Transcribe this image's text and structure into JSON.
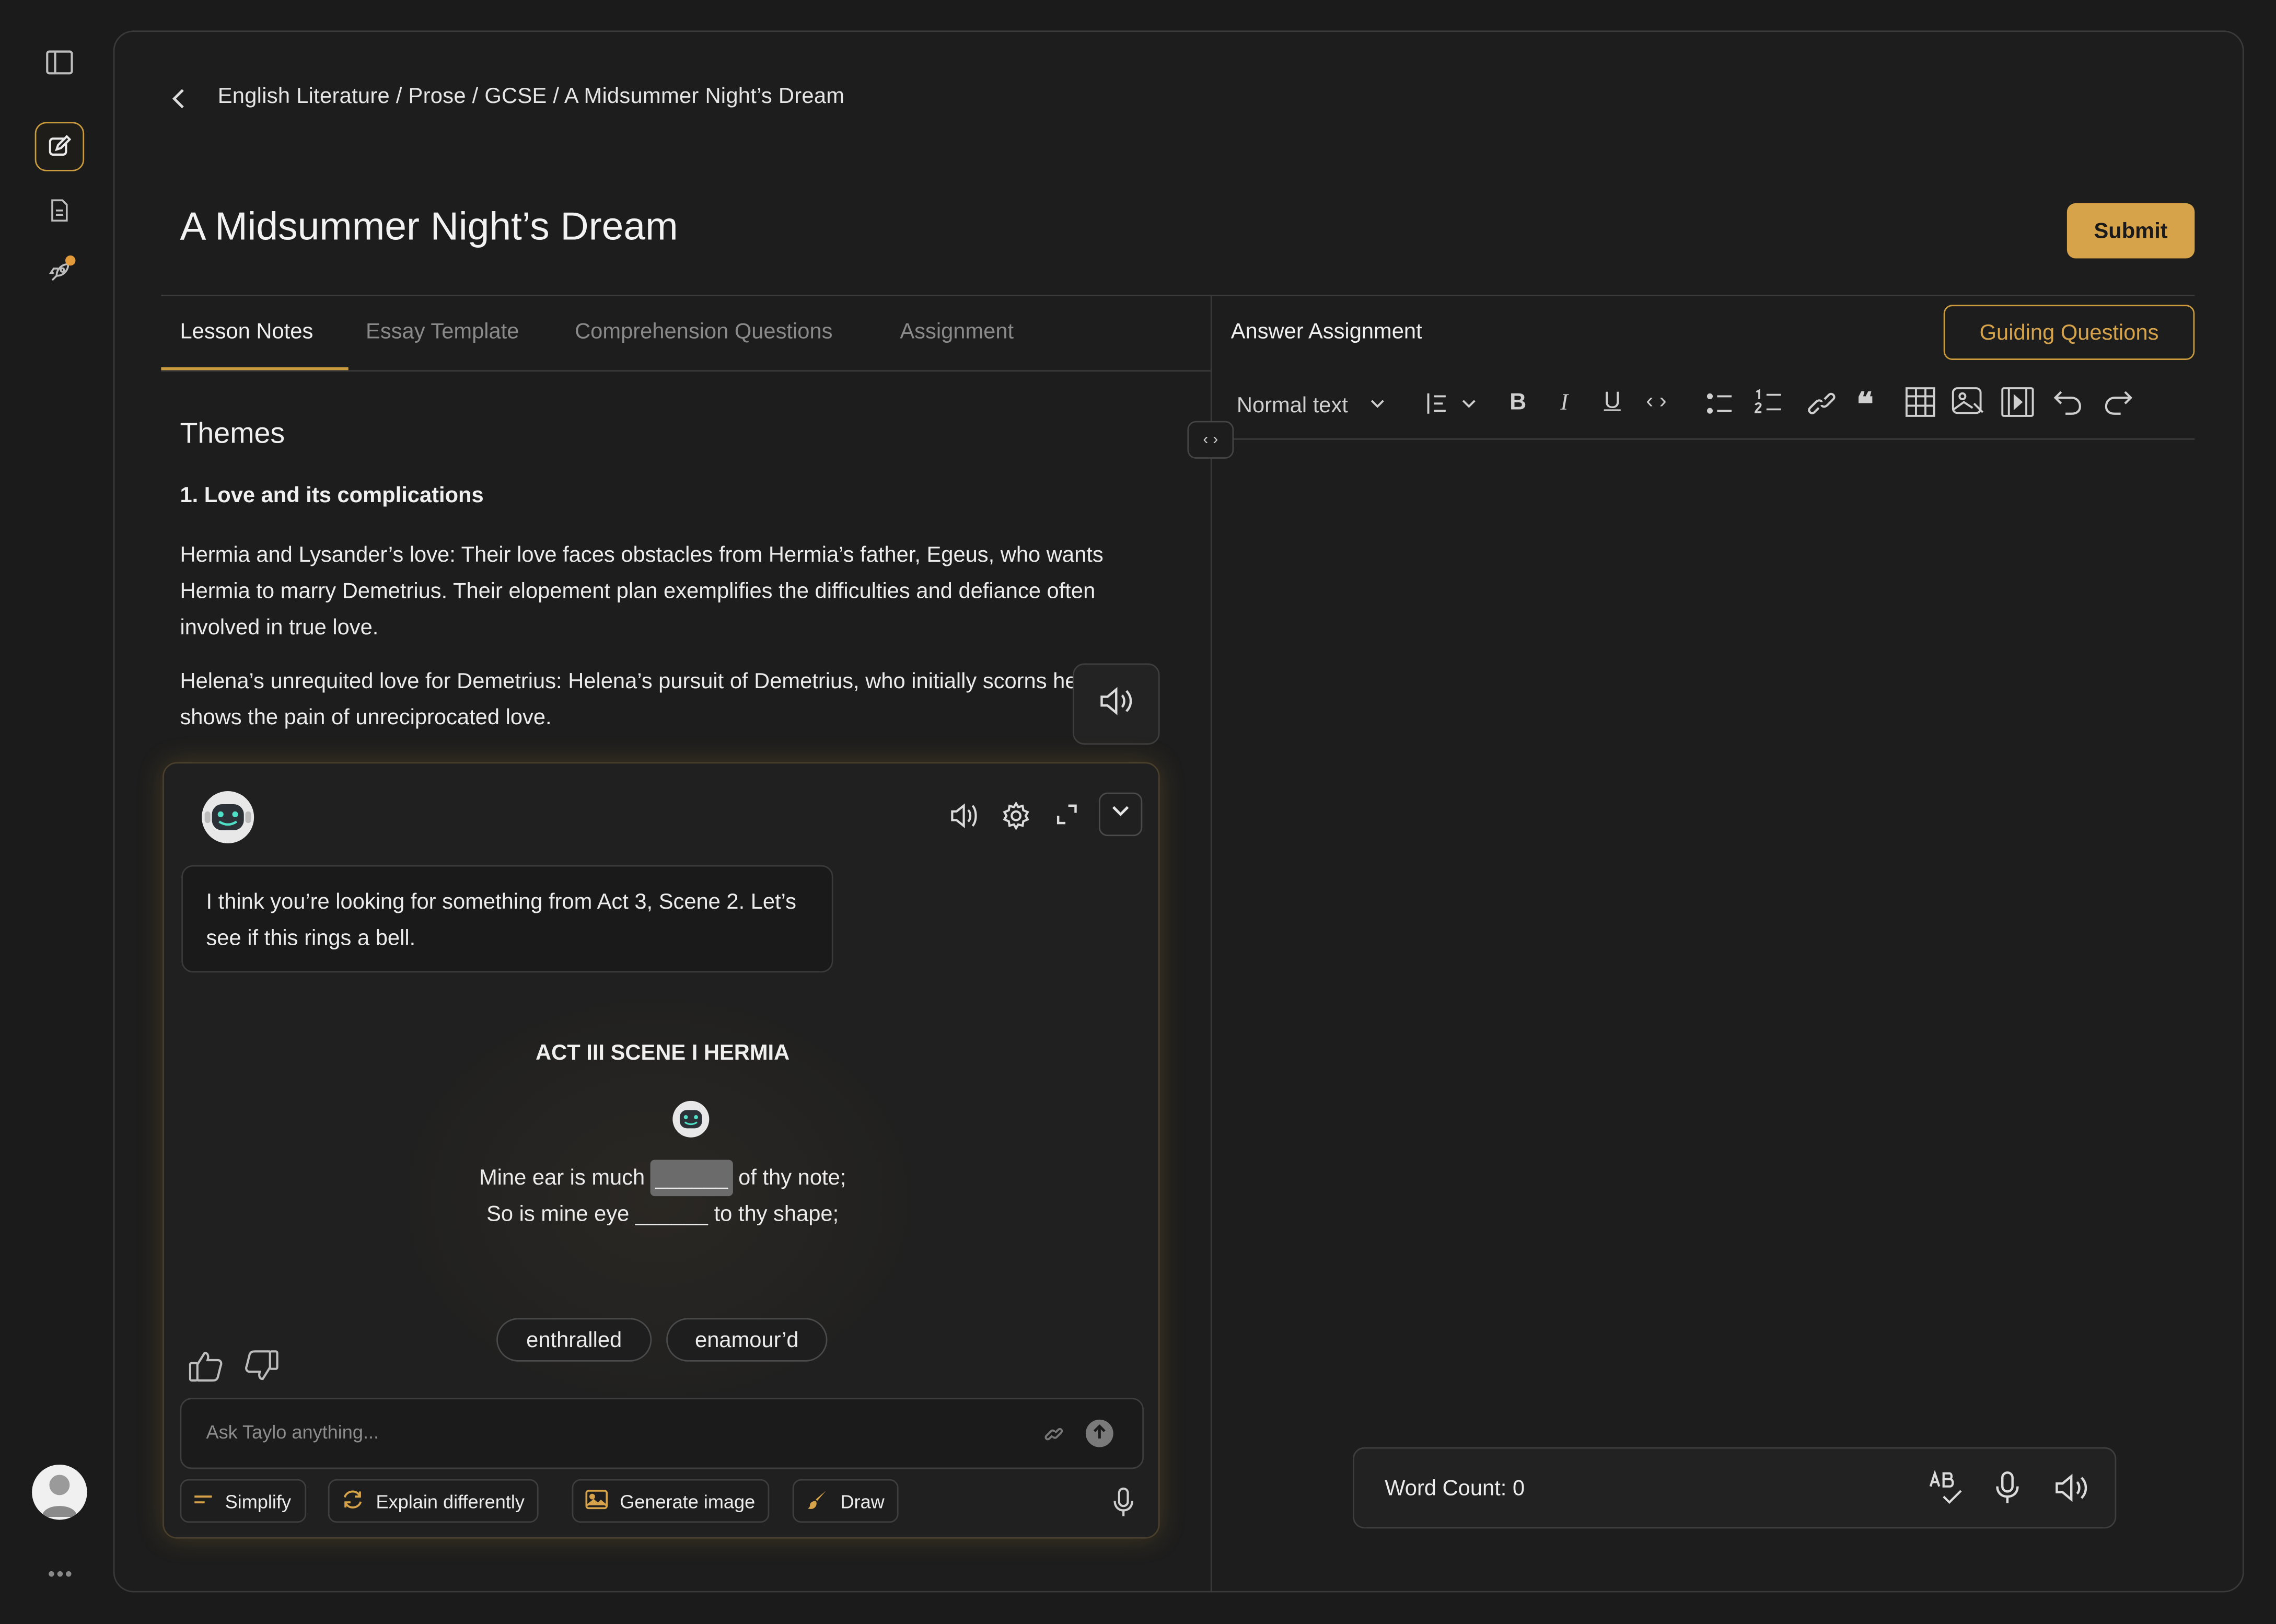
{
  "breadcrumb": "English Literature / Prose / GCSE / A Midsummer Night’s Dream",
  "page_title": "A Midsummer Night’s Dream",
  "submit_label": "Submit",
  "tabs": [
    {
      "label": "Lesson Notes"
    },
    {
      "label": "Essay Template"
    },
    {
      "label": "Comprehension Questions"
    },
    {
      "label": "Assignment"
    }
  ],
  "answer": {
    "title": "Answer Assignment",
    "guiding_label": "Guiding Questions",
    "format_label": "Normal text"
  },
  "notes": {
    "heading": "Themes",
    "subheading": "1. Love and its complications",
    "para1": "Hermia and Lysander’s love: Their love faces obstacles from Hermia’s father, Egeus, who wants Hermia to marry Demetrius. Their elopement plan exemplifies the difficulties and defiance often involved in true love.",
    "para2": "Helena’s unrequited love for Demetrius: Helena’s pursuit of Demetrius, who initially scorns her, shows the pain of unreciprocated love."
  },
  "chat": {
    "message": "I think you’re looking for something from Act 3, Scene 2. Let’s see if this rings a bell.",
    "act_title": "ACT III SCENE I HERMIA",
    "line1_pre": "Mine ear is much",
    "line1_blank": "______",
    "line1_post": "of thy note;",
    "line2": "So is mine eye ______ to thy shape;",
    "options": [
      "enthralled",
      "enamour’d"
    ],
    "input_placeholder": "Ask Taylo anything...",
    "actions": {
      "simplify": "Simplify",
      "explain": "Explain differently",
      "generate": "Generate image",
      "draw": "Draw"
    }
  },
  "word_count": "Word Count: 0",
  "colors": {
    "accent": "#d7a34a",
    "background": "#1b1b1b",
    "panel": "#1d1d1d"
  }
}
